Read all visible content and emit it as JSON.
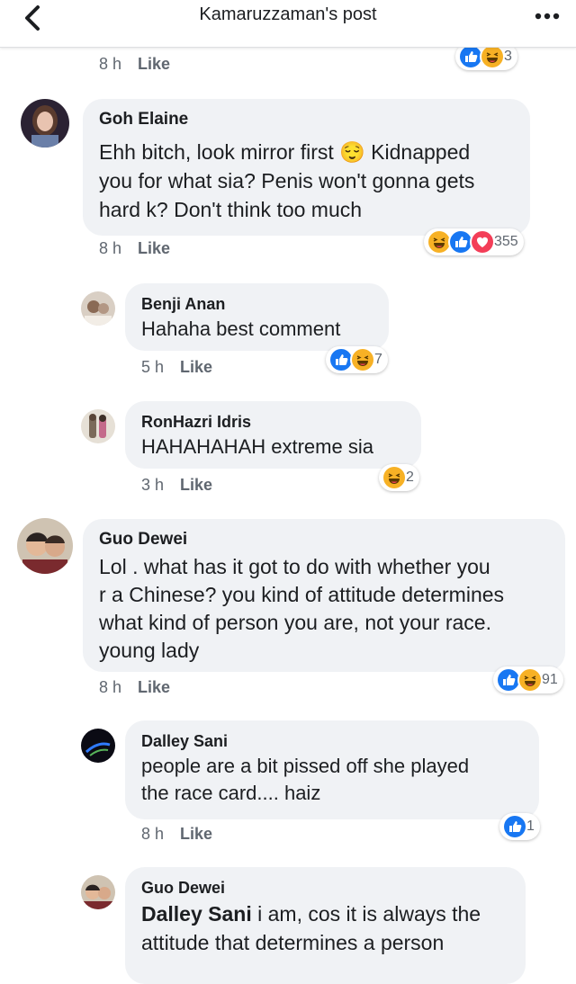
{
  "header": {
    "title": "Kamaruzzaman's post",
    "back_icon": "chevron-left-icon",
    "more_icon": "more-dots-icon"
  },
  "top_partial": {
    "time": "8 h",
    "like_label": "Like",
    "reaction_count": "3"
  },
  "comments": [
    {
      "author": "Goh Elaine",
      "lines": [
        "Ehh bitch, look mirror first 😌 Kidnapped",
        "you for what sia? Penis won't gonna gets",
        "hard k? Don't think too much"
      ],
      "time": "8 h",
      "like_label": "Like",
      "reaction_count": "355"
    },
    {
      "author": "Benji Anan",
      "lines": [
        "Hahaha best comment"
      ],
      "time": "5 h",
      "like_label": "Like",
      "reaction_count": "7"
    },
    {
      "author": "RonHazri Idris",
      "lines": [
        "HAHAHAHAH extreme sia"
      ],
      "time": "3 h",
      "like_label": "Like",
      "reaction_count": "2"
    },
    {
      "author": "Guo Dewei",
      "lines": [
        "Lol . what has it got to do with whether you",
        "r a Chinese? you kind of attitude determines",
        "what kind of person you are, not your race.",
        "young lady"
      ],
      "time": "8 h",
      "like_label": "Like",
      "reaction_count": "91"
    },
    {
      "author": "Dalley Sani",
      "lines": [
        "people are a bit pissed off she played",
        "the race card.... haiz"
      ],
      "time": "8 h",
      "like_label": "Like",
      "reaction_count": "1"
    },
    {
      "author": "Guo Dewei",
      "mention": "Dalley Sani",
      "line1_rest": " i am, cos it is always the",
      "lines": [
        "attitude that determines a person"
      ]
    }
  ],
  "colors": {
    "like_blue": "#1877f2",
    "love_red": "#f33e58",
    "haha_yellow": "#f7b125",
    "bubble_bg": "#f0f2f5",
    "meta_gray": "#606770"
  }
}
